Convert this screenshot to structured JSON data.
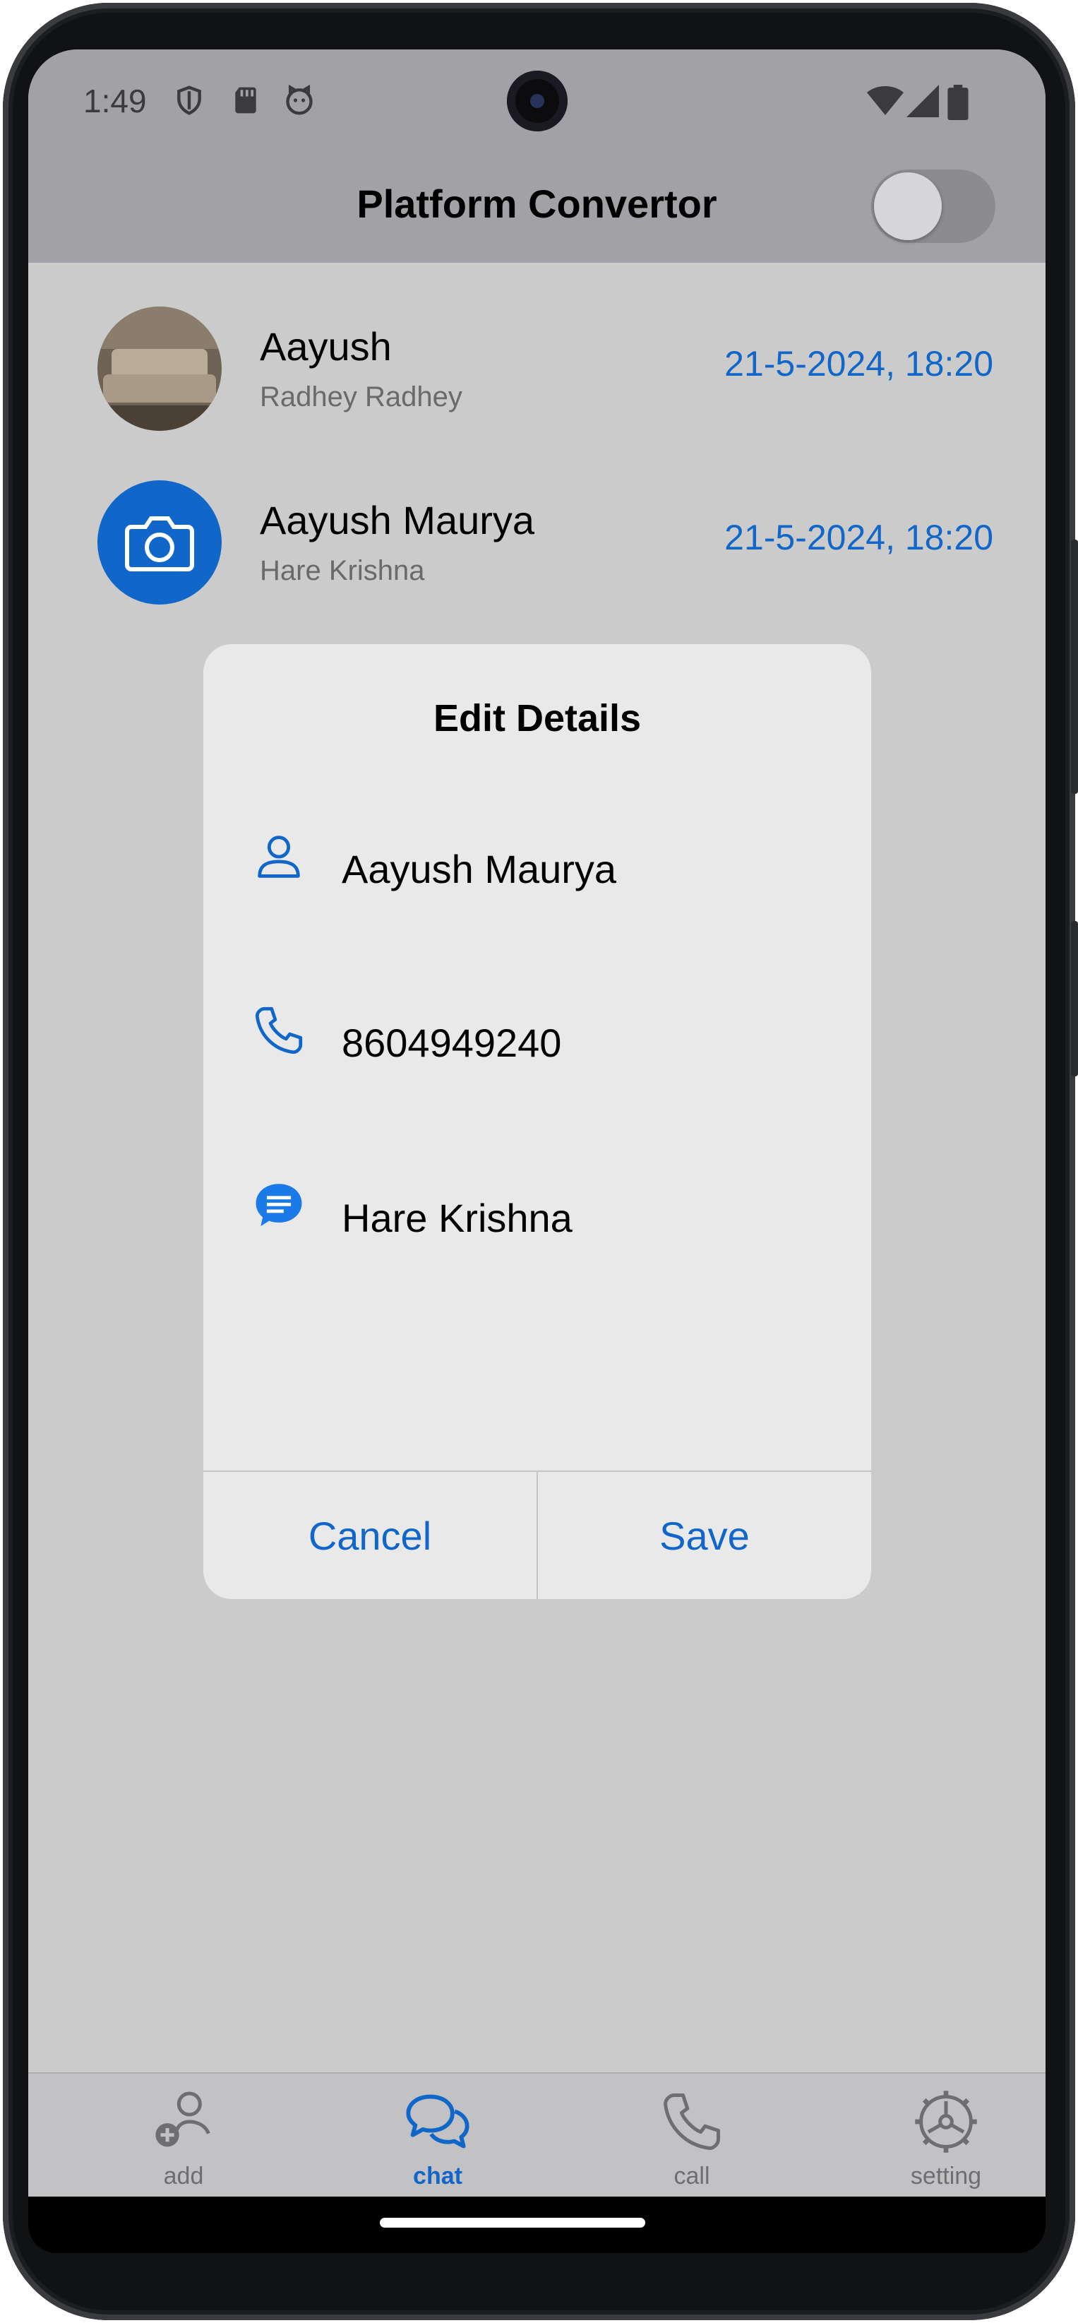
{
  "status_bar": {
    "time": "1:49"
  },
  "app_bar": {
    "title": "Platform Convertor",
    "platform_toggle_on": false
  },
  "chats": [
    {
      "name": "Aayush",
      "message": "Radhey Radhey",
      "time": "21-5-2024, 18:20",
      "avatar": "photo"
    },
    {
      "name": "Aayush Maurya",
      "message": "Hare Krishna",
      "time": "21-5-2024, 18:20",
      "avatar": "camera-icon"
    }
  ],
  "dialog": {
    "title": "Edit Details",
    "name_value": "Aayush Maurya",
    "phone_value": "8604949240",
    "message_value": "Hare Krishna",
    "cancel_label": "Cancel",
    "save_label": "Save"
  },
  "bottom_nav": {
    "items": [
      {
        "label": "add",
        "icon": "add-person-icon",
        "active": false
      },
      {
        "label": "chat",
        "icon": "chat-bubbles-icon",
        "active": true
      },
      {
        "label": "call",
        "icon": "phone-icon",
        "active": false
      },
      {
        "label": "setting",
        "icon": "gear-icon",
        "active": false
      }
    ]
  },
  "colors": {
    "accent": "#1167c9",
    "dialog_bg": "#e9e9e9",
    "scrim": "#cbcbcb"
  }
}
